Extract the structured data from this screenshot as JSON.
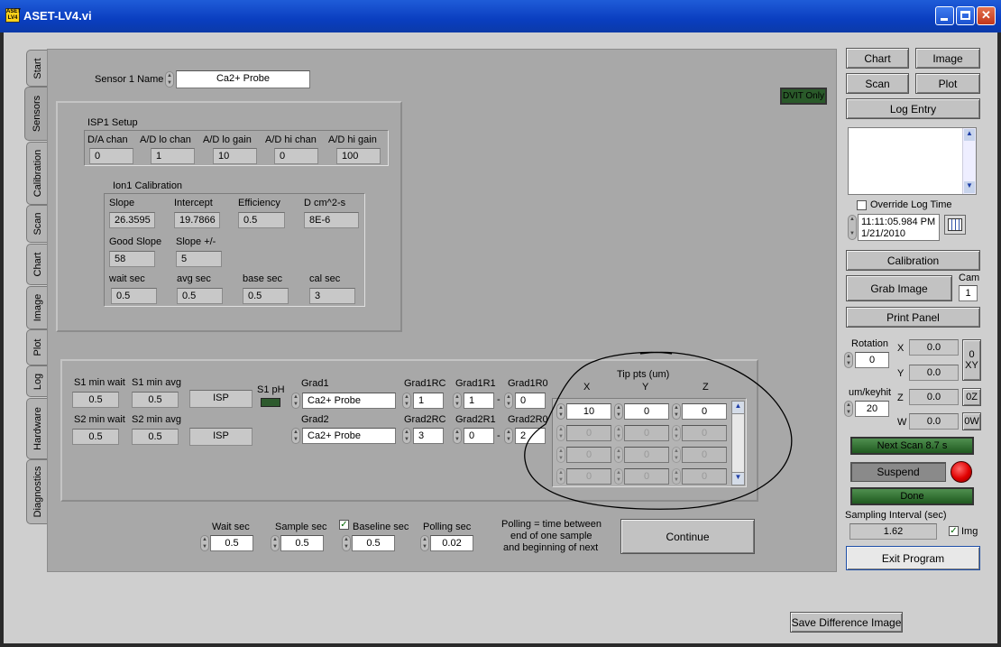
{
  "window": {
    "title": "ASET-LV4.vi",
    "icon_text": "ASET LV4"
  },
  "tabs": [
    "Start",
    "Sensors",
    "Calibration",
    "Scan",
    "Chart",
    "Image",
    "Plot",
    "Log",
    "Hardware",
    "Diagnostics"
  ],
  "sensor": {
    "name_label": "Sensor 1 Name",
    "name_value": "Ca2+ Probe"
  },
  "dvit": "DVIT Only",
  "isp1": {
    "title": "ISP1 Setup",
    "headers": [
      "D/A chan",
      "A/D lo chan",
      "A/D lo gain",
      "A/D hi chan",
      "A/D hi gain"
    ],
    "values": [
      "0",
      "1",
      "10",
      "0",
      "100"
    ]
  },
  "ion1": {
    "title": "Ion1 Calibration",
    "row1_labels": [
      "Slope",
      "Intercept",
      "Efficiency",
      "D cm^2-s"
    ],
    "row1_values": [
      "26.3595",
      "19.7866",
      "0.5",
      "8E-6"
    ],
    "row2_labels": [
      "Good Slope",
      "Slope +/-"
    ],
    "row2_values": [
      "58",
      "5"
    ],
    "row3_labels": [
      "wait sec",
      "avg sec",
      "base sec",
      "cal sec"
    ],
    "row3_values": [
      "0.5",
      "0.5",
      "0.5",
      "3"
    ]
  },
  "grad": {
    "s1_min_wait_label": "S1 min wait",
    "s1_min_wait": "0.5",
    "s1_min_avg_label": "S1 min avg",
    "s1_min_avg": "0.5",
    "s2_min_wait_label": "S2 min wait",
    "s2_min_wait": "0.5",
    "s2_min_avg_label": "S2 min avg",
    "s2_min_avg": "0.5",
    "isp1": "ISP",
    "isp2": "ISP",
    "s1ph_label": "S1 pH",
    "grad1_label": "Grad1",
    "grad1_value": "Ca2+ Probe",
    "grad2_label": "Grad2",
    "grad2_value": "Ca2+ Probe",
    "g1rc_label": "Grad1RC",
    "g1rc": "1",
    "g1r1_label": "Grad1R1",
    "g1r1": "1",
    "g1r0_label": "Grad1R0",
    "g1r0": "0",
    "g2rc_label": "Grad2RC",
    "g2rc": "3",
    "g2r1_label": "Grad2R1",
    "g2r1": "0",
    "g2r0_label": "Grad2R0",
    "g2r0": "2",
    "dash": "-"
  },
  "tip": {
    "title": "Tip pts (um)",
    "cols": [
      "X",
      "Y",
      "Z"
    ],
    "rows": [
      [
        "10",
        "0",
        "0"
      ],
      [
        "0",
        "0",
        "0"
      ],
      [
        "0",
        "0",
        "0"
      ],
      [
        "0",
        "0",
        "0"
      ]
    ]
  },
  "bottom": {
    "wait_label": "Wait sec",
    "wait": "0.5",
    "sample_label": "Sample sec",
    "sample": "0.5",
    "baseline_label": "Baseline sec",
    "baseline": "0.5",
    "baseline_checked": "✓",
    "polling_label": "Polling sec",
    "polling": "0.02",
    "polling_note": [
      "Polling = time between",
      "end of one sample",
      "and beginning of next"
    ],
    "continue": "Continue"
  },
  "side": {
    "chart": "Chart",
    "image": "Image",
    "scan": "Scan",
    "plot": "Plot",
    "log_entry": "Log Entry",
    "override_label": "Override Log Time",
    "time": "11:11:05.984 PM",
    "date": "1/21/2010",
    "calibration": "Calibration",
    "grab_image": "Grab Image",
    "cam_label": "Cam",
    "cam": "1",
    "print_panel": "Print Panel",
    "rotation_label": "Rotation",
    "rotation": "0",
    "x_label": "X",
    "x": "0.0",
    "y_label": "Y",
    "y": "0.0",
    "z_label": "Z",
    "z": "0.0",
    "w_label": "W",
    "w": "0.0",
    "xy_btn_top": "0",
    "xy_btn_bottom": "XY",
    "z_btn": "0Z",
    "w_btn": "0W",
    "umkey_label": "um/keyhit",
    "umkey": "20",
    "next_scan": "Next Scan 8.7 s",
    "suspend": "Suspend",
    "done": "Done",
    "sampling_label": "Sampling Interval (sec)",
    "sampling": "1.62",
    "img_label": "Img",
    "img_checked": "✓",
    "exit": "Exit Program"
  },
  "save_diff": "Save Difference Image",
  "colors": {
    "title_bar": "#0a3ec0",
    "panel": "#a8a8a8",
    "led_red": "#e00000",
    "led_green": "#2f7a2f"
  }
}
